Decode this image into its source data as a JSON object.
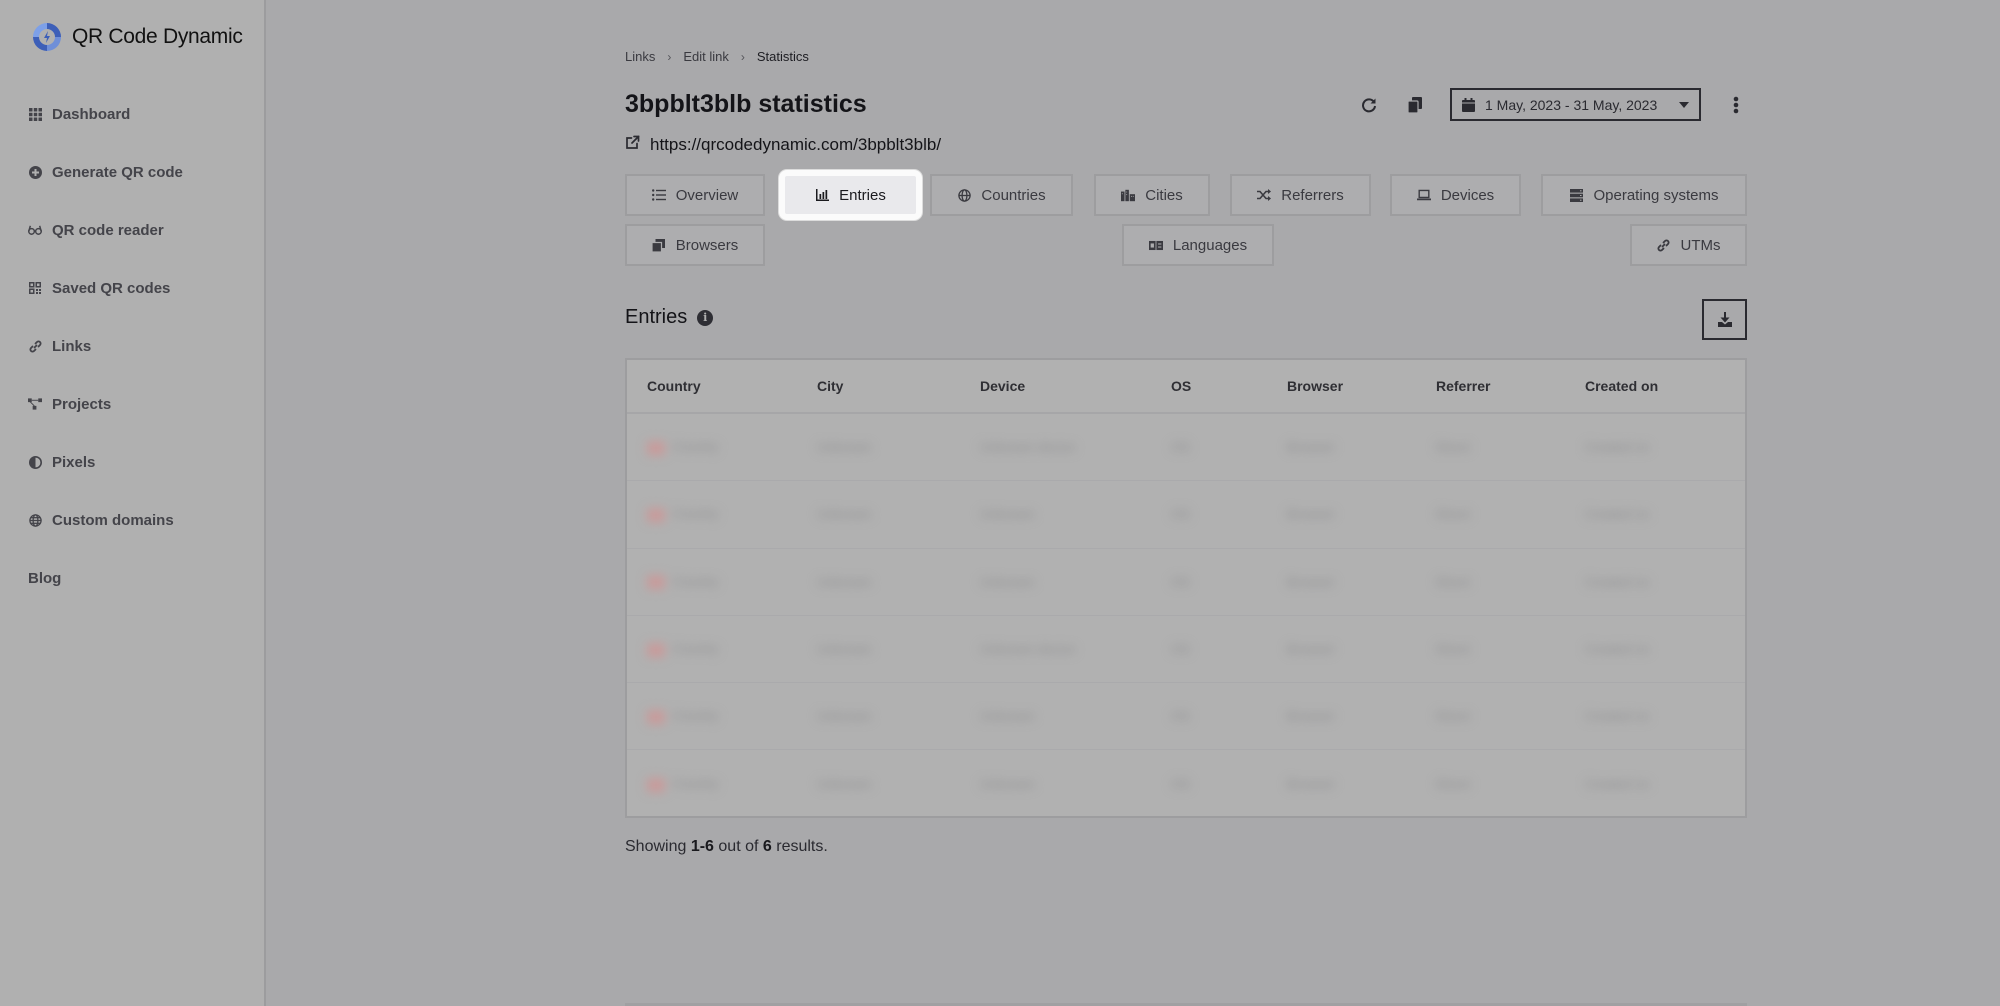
{
  "app": {
    "brand": "QR Code Dynamic",
    "brand_colors": {
      "primary": "#3d5fb8",
      "accent": "#7da0e8"
    }
  },
  "sidebar": {
    "items": [
      {
        "label": "Dashboard",
        "icon": "grid-icon"
      },
      {
        "label": "Generate QR code",
        "icon": "plus-circle-icon"
      },
      {
        "label": "QR code reader",
        "icon": "glasses-icon"
      },
      {
        "label": "Saved QR codes",
        "icon": "qrcode-icon"
      },
      {
        "label": "Links",
        "icon": "link-icon"
      },
      {
        "label": "Projects",
        "icon": "project-diagram-icon"
      },
      {
        "label": "Pixels",
        "icon": "adjust-icon"
      },
      {
        "label": "Custom domains",
        "icon": "globe-icon"
      }
    ],
    "blog_label": "Blog"
  },
  "breadcrumb": {
    "items": [
      "Links",
      "Edit link",
      "Statistics"
    ],
    "separator": "›"
  },
  "page": {
    "title": "3bpblt3blb statistics",
    "url": "https://qrcodedynamic.com/3bpblt3blb/"
  },
  "toolbar": {
    "refresh_icon": "refresh-icon",
    "copy_icon": "copy-icon",
    "date_range": "1 May, 2023 - 31 May, 2023",
    "more_icon": "more-vertical-icon"
  },
  "tabs": [
    {
      "label": "Overview",
      "icon": "list-icon",
      "active": false
    },
    {
      "label": "Entries",
      "icon": "chart-bar-icon",
      "active": true
    },
    {
      "label": "Countries",
      "icon": "globe-icon",
      "active": false
    },
    {
      "label": "Cities",
      "icon": "city-icon",
      "active": false
    },
    {
      "label": "Referrers",
      "icon": "random-icon",
      "active": false
    },
    {
      "label": "Devices",
      "icon": "laptop-icon",
      "active": false
    },
    {
      "label": "Operating systems",
      "icon": "server-icon",
      "active": false
    },
    {
      "label": "Browsers",
      "icon": "window-restore-icon",
      "active": false
    },
    {
      "label": "Languages",
      "icon": "language-icon",
      "active": false
    },
    {
      "label": "UTMs",
      "icon": "link-icon",
      "active": false
    }
  ],
  "entries": {
    "title": "Entries",
    "columns": [
      "Country",
      "City",
      "Device",
      "OS",
      "Browser",
      "Referrer",
      "Created on"
    ],
    "rows_blurred": true,
    "row_count": 6,
    "rows": [
      [
        "Country",
        "Unknown",
        "Unknown device",
        "OS",
        "Browser",
        "Direct",
        "Created on"
      ],
      [
        "Country",
        "Unknown",
        "Unknown",
        "OS",
        "Browser",
        "Direct",
        "Created on"
      ],
      [
        "Country",
        "Unknown",
        "Unknown",
        "OS",
        "Browser",
        "Direct",
        "Created on"
      ],
      [
        "Country",
        "Unknown",
        "Unknown device",
        "OS",
        "Browser",
        "Direct",
        "Created on"
      ],
      [
        "Country",
        "Unknown",
        "Unknown",
        "OS",
        "Browser",
        "Direct",
        "Created on"
      ],
      [
        "Country",
        "Unknown",
        "Unknown",
        "OS",
        "Browser",
        "Direct",
        "Created on"
      ]
    ]
  },
  "pagination": {
    "prefix": "Showing",
    "range": "1-6",
    "middle": "out of",
    "total": "6",
    "suffix": "results."
  }
}
